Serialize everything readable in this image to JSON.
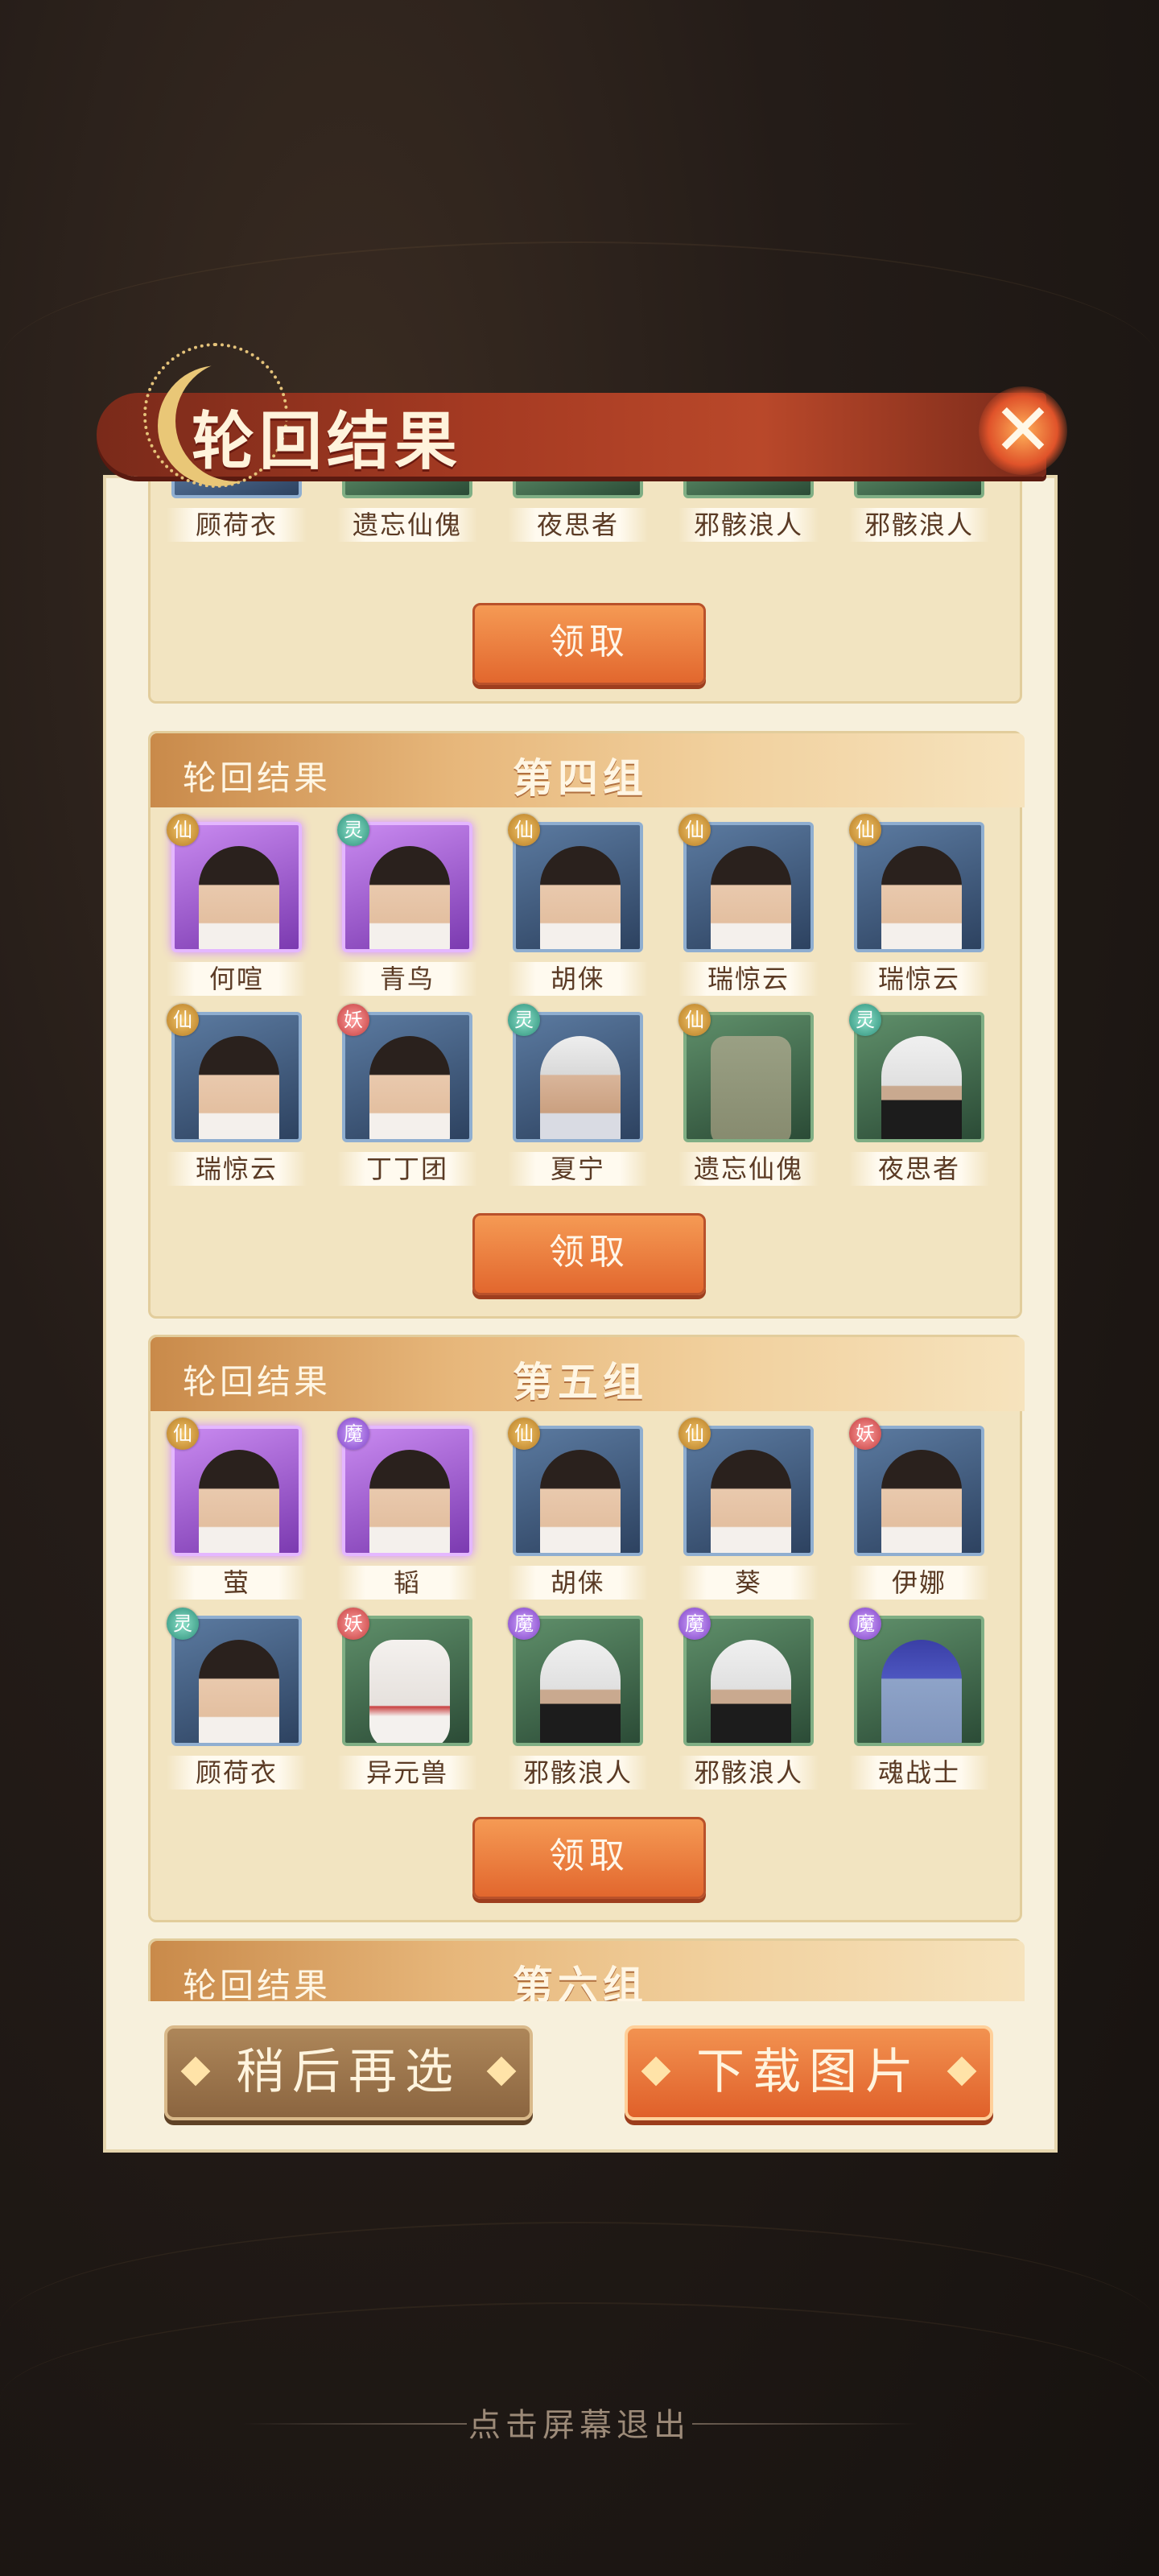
{
  "dialog": {
    "title": "轮回结果",
    "close_icon": "close-icon"
  },
  "groups": [
    {
      "label": "",
      "name": "",
      "claim_label": "领取",
      "partial": true,
      "members": [
        {
          "name": "顾荷衣"
        },
        {
          "name": "遗忘仙傀"
        },
        {
          "name": "夜思者"
        },
        {
          "name": "邪骸浪人"
        },
        {
          "name": "邪骸浪人"
        }
      ]
    },
    {
      "label": "轮回结果",
      "name": "第四组",
      "claim_label": "领取",
      "members": [
        {
          "name": "何喧",
          "badge": "仙",
          "rarity": "purple"
        },
        {
          "name": "青鸟",
          "badge": "灵",
          "rarity": "purple"
        },
        {
          "name": "胡俫",
          "badge": "仙",
          "rarity": "blue"
        },
        {
          "name": "瑞惊云",
          "badge": "仙",
          "rarity": "blue"
        },
        {
          "name": "瑞惊云",
          "badge": "仙",
          "rarity": "blue"
        },
        {
          "name": "瑞惊云",
          "badge": "仙",
          "rarity": "blue"
        },
        {
          "name": "丁丁团",
          "badge": "妖",
          "rarity": "blue"
        },
        {
          "name": "夏宁",
          "badge": "灵",
          "rarity": "blue"
        },
        {
          "name": "遗忘仙傀",
          "badge": "仙",
          "rarity": "green"
        },
        {
          "name": "夜思者",
          "badge": "灵",
          "rarity": "green"
        }
      ]
    },
    {
      "label": "轮回结果",
      "name": "第五组",
      "claim_label": "领取",
      "members": [
        {
          "name": "萤",
          "badge": "仙",
          "rarity": "purple"
        },
        {
          "name": "韬",
          "badge": "魔",
          "rarity": "purple"
        },
        {
          "name": "胡俫",
          "badge": "仙",
          "rarity": "blue"
        },
        {
          "name": "葵",
          "badge": "仙",
          "rarity": "blue"
        },
        {
          "name": "伊娜",
          "badge": "妖",
          "rarity": "blue"
        },
        {
          "name": "顾荷衣",
          "badge": "灵",
          "rarity": "blue"
        },
        {
          "name": "异元兽",
          "badge": "妖",
          "rarity": "green"
        },
        {
          "name": "邪骸浪人",
          "badge": "魔",
          "rarity": "green"
        },
        {
          "name": "邪骸浪人",
          "badge": "魔",
          "rarity": "green"
        },
        {
          "name": "魂战士",
          "badge": "魔",
          "rarity": "green"
        }
      ]
    },
    {
      "label": "轮回结果",
      "name": "第六组"
    }
  ],
  "footer": {
    "later_label": "稍后再选",
    "download_label": "下载图片",
    "exit_hint": "点击屏幕退出"
  }
}
